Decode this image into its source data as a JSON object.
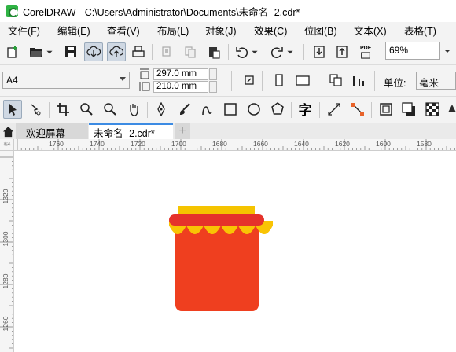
{
  "window": {
    "title": "CorelDRAW - C:\\Users\\Administrator\\Documents\\未命名 -2.cdr*"
  },
  "menu": {
    "items": [
      "文件(F)",
      "编辑(E)",
      "查看(V)",
      "布局(L)",
      "对象(J)",
      "效果(C)",
      "位图(B)",
      "文本(X)",
      "表格(T)"
    ]
  },
  "toolbar": {
    "zoom_value": "69%",
    "pdf_label": "PDF"
  },
  "property_bar": {
    "page_size": "A4",
    "width_value": "297.0 mm",
    "height_value": "210.0 mm",
    "units_label": "单位:",
    "units_value": "毫米"
  },
  "tools": {
    "text_tool_glyph": "字"
  },
  "tabs": {
    "welcome": "欢迎屏幕",
    "document": "未命名 -2.cdr*",
    "add": "+"
  },
  "rulers": {
    "unit_corner": "毫米",
    "horizontal_ticks": [
      "1760",
      "1740",
      "1720",
      "1700",
      "1680",
      "1660",
      "1640",
      "1620",
      "1600",
      "1580"
    ],
    "vertical_ticks": [
      "1320",
      "1300",
      "1280",
      "1260"
    ]
  },
  "drawing": {
    "jar_body_color": "#ef3f1f",
    "lid_band_color": "#e5322b",
    "lid_top_color": "#f5c400",
    "lid_scallop_color": "#f9c404"
  }
}
